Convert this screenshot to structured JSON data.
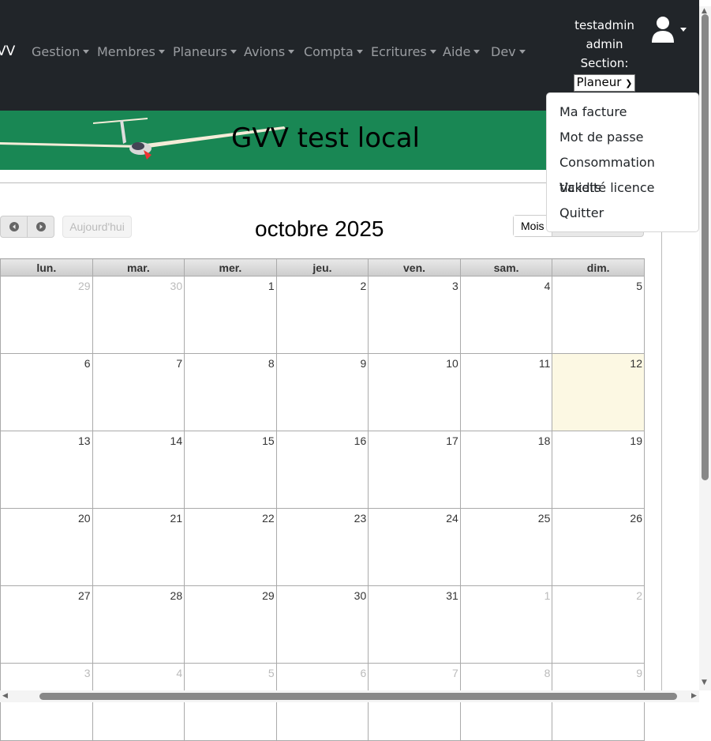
{
  "navbar": {
    "brand": "VV",
    "menus": [
      "Gestion",
      "Membres",
      "Planeurs",
      "Avions",
      "Compta",
      "Ecritures",
      "Aide",
      "Dev"
    ],
    "user": {
      "name": "testadmin",
      "role": "admin",
      "section_label": "Section:",
      "section_value": "Planeur"
    }
  },
  "banner": {
    "title": "GVV test local"
  },
  "user_menu": [
    "Ma facture",
    "Mot de passe",
    "Consommation tickets",
    "Validité licence",
    "Quitter"
  ],
  "calendar": {
    "title": "octobre 2025",
    "today_label": "Aujourd'hui",
    "view_label": "Mois",
    "weekdays": [
      "lun.",
      "mar.",
      "mer.",
      "jeu.",
      "ven.",
      "sam.",
      "dim."
    ],
    "weeks": [
      [
        {
          "d": "29",
          "o": 1
        },
        {
          "d": "30",
          "o": 1
        },
        {
          "d": "1"
        },
        {
          "d": "2"
        },
        {
          "d": "3"
        },
        {
          "d": "4"
        },
        {
          "d": "5"
        }
      ],
      [
        {
          "d": "6"
        },
        {
          "d": "7"
        },
        {
          "d": "8"
        },
        {
          "d": "9"
        },
        {
          "d": "10"
        },
        {
          "d": "11"
        },
        {
          "d": "12",
          "t": 1
        }
      ],
      [
        {
          "d": "13"
        },
        {
          "d": "14"
        },
        {
          "d": "15"
        },
        {
          "d": "16"
        },
        {
          "d": "17"
        },
        {
          "d": "18"
        },
        {
          "d": "19"
        }
      ],
      [
        {
          "d": "20"
        },
        {
          "d": "21"
        },
        {
          "d": "22"
        },
        {
          "d": "23"
        },
        {
          "d": "24"
        },
        {
          "d": "25"
        },
        {
          "d": "26"
        }
      ],
      [
        {
          "d": "27"
        },
        {
          "d": "28"
        },
        {
          "d": "29"
        },
        {
          "d": "30"
        },
        {
          "d": "31"
        },
        {
          "d": "1",
          "o": 1
        },
        {
          "d": "2",
          "o": 1
        }
      ],
      [
        {
          "d": "3",
          "o": 1
        },
        {
          "d": "4",
          "o": 1
        },
        {
          "d": "5",
          "o": 1
        },
        {
          "d": "6",
          "o": 1
        },
        {
          "d": "7",
          "o": 1
        },
        {
          "d": "8",
          "o": 1
        },
        {
          "d": "9",
          "o": 1
        }
      ]
    ]
  }
}
